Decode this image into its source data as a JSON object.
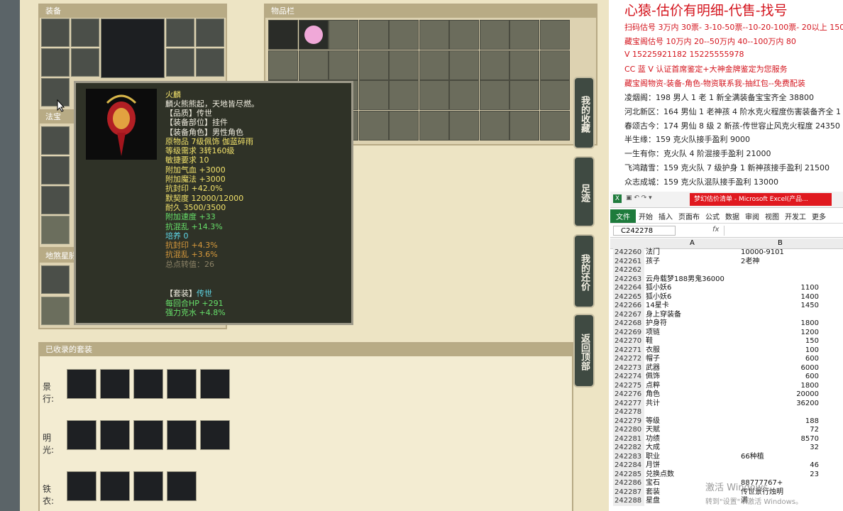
{
  "panels": {
    "equip_title": "装备",
    "fabao_title": "法宝",
    "sha_title": "地煞星脉",
    "items_title": "物品栏",
    "sets_title": "已收录的套装"
  },
  "side_buttons": [
    "我的收藏",
    "足迹",
    "我的还价",
    "返回顶部"
  ],
  "tooltip": {
    "name": "火麟",
    "desc": "麟火熊熊起，天地皆尽燃。",
    "lines": [
      {
        "t": "【品质】传世",
        "c": "w"
      },
      {
        "t": "【装备部位】挂件",
        "c": "w"
      },
      {
        "t": "【装备角色】男性角色",
        "c": "w"
      },
      {
        "t": "原物品 7级佩饰 伽蓝碎雨",
        "c": "y"
      },
      {
        "t": "等级需求 3转160级",
        "c": "y"
      },
      {
        "t": "敏捷要求 10",
        "c": "y"
      },
      {
        "t": "附加气血 +3000",
        "c": "y"
      },
      {
        "t": "附加魔法 +3000",
        "c": "y"
      },
      {
        "t": "抗封印 +42.0%",
        "c": "y"
      },
      {
        "t": "默契度 12000/12000",
        "c": "y"
      },
      {
        "t": "耐久 3500/3500",
        "c": "y"
      },
      {
        "t": "附加速度 +33",
        "c": "g"
      },
      {
        "t": "抗混乱 +14.3%",
        "c": "g"
      },
      {
        "t": "培养 0",
        "c": "c"
      },
      {
        "t": "抗封印 +4.3%",
        "c": "o"
      },
      {
        "t": "抗混乱 +3.6%",
        "c": "o"
      },
      {
        "t": "总点转值：26",
        "c": "b"
      }
    ],
    "set_label": "【套装】",
    "set_name": "传世",
    "set_lines": [
      "每回合HP +291",
      "强力克水 +4.8%"
    ]
  },
  "sets": [
    {
      "label": "景行:",
      "count": 5
    },
    {
      "label": "明光:",
      "count": 5
    },
    {
      "label": "铁衣:",
      "count": 4
    }
  ],
  "ads": [
    {
      "t": "心猿-估价有明细-代售-找号",
      "big": true
    },
    {
      "t": "扫码估号 3万内 30票- 3-10-50票--10-20-100票- 20以上 150"
    },
    {
      "t": "藏宝阁估号 10万内 20--50万内 40--100万内 80"
    },
    {
      "t": "V 15225921182   15225555978"
    },
    {
      "t": "CC 蓝 V 认证首席鉴定+大神金牌鉴定为您服务"
    },
    {
      "t": "藏宝阁物资-装备-角色-物资联系我-抽红包--免费配装"
    },
    {
      "t": "凌烟阁：198 男人 1 老 1 新全满装备宝宝齐全 38800",
      "k": true
    },
    {
      "t": "河北新区：164 男仙 1 老神孩 4 阶水克火程度伤害装备齐全 1",
      "k": true
    },
    {
      "t": "春颂古今：174 男仙 8 级 2 新孩-传世容止风克火程度 24350",
      "k": true
    },
    {
      "t": "半生缘：159 克火队接手盈利 9000",
      "k": true
    },
    {
      "t": "一生有你：克火队 4 阶混接手盈利 21000",
      "k": true
    },
    {
      "t": "飞鸿踏雪：159 克火队 7 级护身 1 新神孩接手盈利 21500",
      "k": true
    },
    {
      "t": "众志成城：159 克火队混队接手盈利 13000",
      "k": true
    }
  ],
  "excel": {
    "title": "梦幻估价清单 - Microsoft Excel(产品...",
    "tabs": [
      "文件",
      "开始",
      "插入",
      "页面布",
      "公式",
      "数据",
      "审阅",
      "视图",
      "开发工",
      "更多"
    ],
    "namebox": "C242278",
    "fx": "fx",
    "col_a": "A",
    "col_b": "B",
    "rows": [
      [
        "242260",
        "法门",
        "10000-9101",
        "l"
      ],
      [
        "242261",
        "孩子",
        "2老神",
        "l"
      ],
      [
        "242262",
        "",
        "",
        "l"
      ],
      [
        "242263",
        "云舟载梦188男鬼36000",
        "",
        "l"
      ],
      [
        "242264",
        "狐小妖6",
        "1100",
        "r"
      ],
      [
        "242265",
        "狐小妖6",
        "1400",
        "r"
      ],
      [
        "242266",
        "14星卡",
        "1450",
        "r"
      ],
      [
        "242267",
        "身上穿装备",
        "",
        "l"
      ],
      [
        "242268",
        "护身符",
        "1800",
        "r"
      ],
      [
        "242269",
        "项链",
        "1200",
        "r"
      ],
      [
        "242270",
        "鞋",
        "150",
        "r"
      ],
      [
        "242271",
        "衣服",
        "100",
        "r"
      ],
      [
        "242272",
        "帽子",
        "600",
        "r"
      ],
      [
        "242273",
        "武器",
        "6000",
        "r"
      ],
      [
        "242274",
        "佩饰",
        "600",
        "r"
      ],
      [
        "242275",
        "点粹",
        "1800",
        "r"
      ],
      [
        "242276",
        "角色",
        "20000",
        "r"
      ],
      [
        "242277",
        "共计",
        "36200",
        "r"
      ],
      [
        "242278",
        "",
        "",
        "l"
      ],
      [
        "242279",
        "等级",
        "188",
        "r"
      ],
      [
        "242280",
        "天赋",
        "72",
        "r"
      ],
      [
        "242281",
        "功绩",
        "8570",
        "r"
      ],
      [
        "242282",
        "大成",
        "32",
        "r"
      ],
      [
        "242283",
        "职业",
        "66种植",
        "l"
      ],
      [
        "242284",
        "月饼",
        "46",
        "r"
      ],
      [
        "242285",
        "兑换点数",
        "23",
        "r"
      ],
      [
        "242286",
        "宝石",
        "88777767+",
        "l"
      ],
      [
        "242287",
        "套装",
        "传世景行烛明",
        "l"
      ],
      [
        "242288",
        "星盘",
        "满",
        "l"
      ]
    ]
  },
  "watermark": [
    "激活 Windows",
    "转到\"设置\"以激活 Windows。"
  ]
}
